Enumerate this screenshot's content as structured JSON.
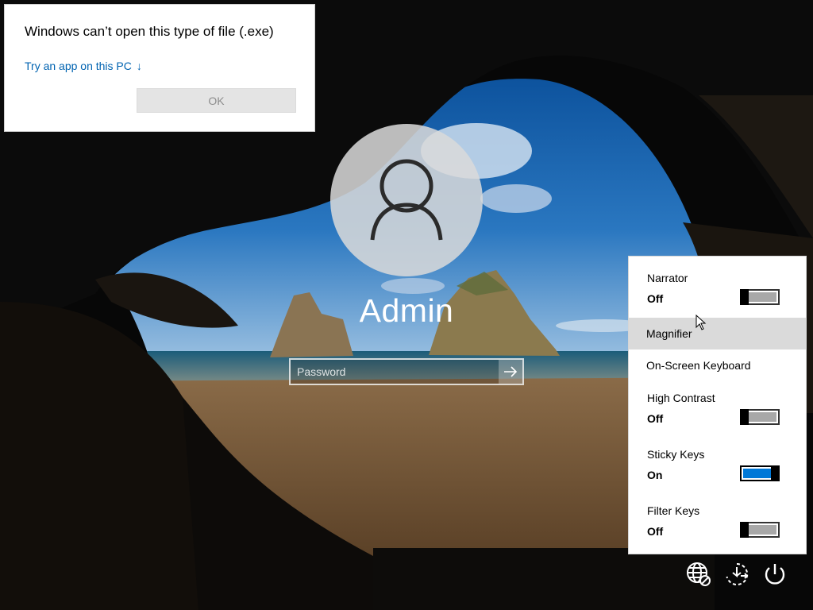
{
  "error_dialog": {
    "title": "Windows can’t open this type of file (.exe)",
    "link_text": "Try an app on this PC",
    "link_arrow": "↓",
    "ok_label": "OK"
  },
  "login": {
    "user_name": "Admin",
    "password_placeholder": "Password",
    "submit_icon": "arrow-right-icon"
  },
  "ease_of_access": {
    "narrator": {
      "label": "Narrator",
      "state": "Off",
      "on": false
    },
    "magnifier": {
      "label": "Magnifier"
    },
    "on_screen_keyboard": {
      "label": "On-Screen Keyboard"
    },
    "high_contrast": {
      "label": "High Contrast",
      "state": "Off",
      "on": false
    },
    "sticky_keys": {
      "label": "Sticky Keys",
      "state": "On",
      "on": true
    },
    "filter_keys": {
      "label": "Filter Keys",
      "state": "Off",
      "on": false
    }
  },
  "tray": {
    "icons": [
      "network-icon",
      "ease-of-access-icon",
      "power-icon"
    ]
  },
  "colors": {
    "link": "#0063b1",
    "toggle_on": "#0078d7",
    "menu_highlight": "#dadada"
  }
}
